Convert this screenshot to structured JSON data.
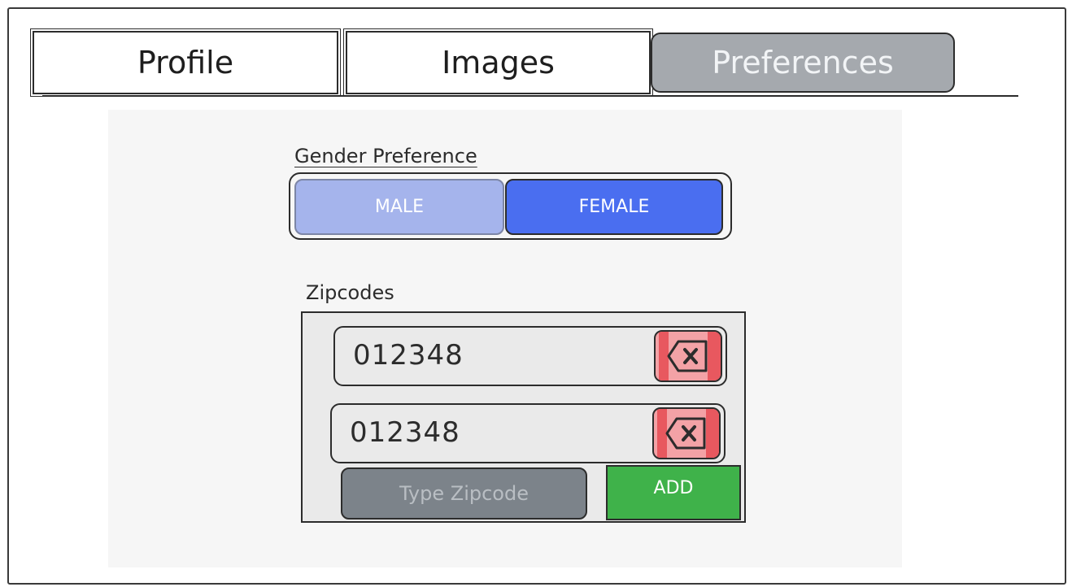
{
  "tabs": [
    {
      "label": "Profile",
      "active": false
    },
    {
      "label": "Images",
      "active": false
    },
    {
      "label": "Preferences",
      "active": true
    }
  ],
  "gender": {
    "label": "Gender Preference",
    "options": [
      "MALE",
      "FEMALE"
    ],
    "selected": "FEMALE"
  },
  "zipcodes": {
    "label": "Zipcodes",
    "items": [
      {
        "value": "012348",
        "delete_icon": "backspace-x-icon"
      },
      {
        "value": "012348",
        "delete_icon": "backspace-x-icon"
      }
    ],
    "input_placeholder": "Type Zipcode",
    "add_label": "ADD"
  },
  "colors": {
    "active_tab": "#a5a9ae",
    "male": "#a5b4ec",
    "female": "#4a6ef0",
    "delete": "#e8585f",
    "add": "#3fb24a",
    "input": "#7c838a"
  }
}
